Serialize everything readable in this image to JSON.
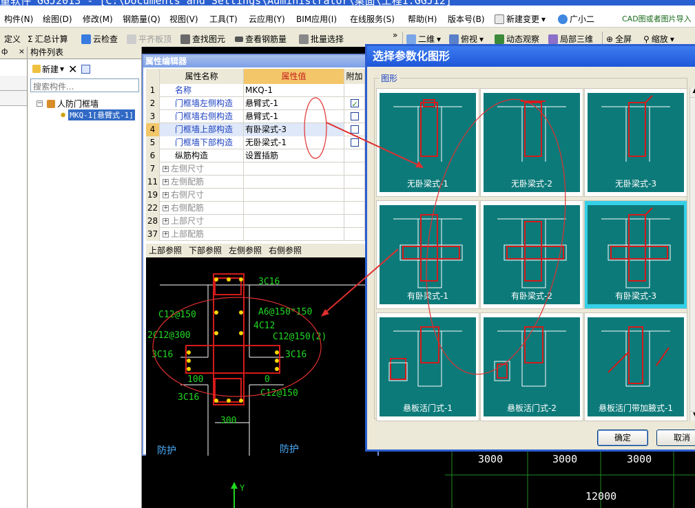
{
  "title": "量软件 GGJ2013 - [C:\\Documents and Settings\\Administrator\\桌面\\工程1.GGJ12]",
  "menu": [
    "构件(N)",
    "绘图(D)",
    "修改(M)",
    "钢筋量(Q)",
    "视图(V)",
    "工具(T)",
    "云应用(Y)",
    "BIM应用(I)",
    "在线服务(S)",
    "帮助(H)",
    "版本号(B)",
    "新建变更",
    "广小二"
  ],
  "menu_right": "CAD图或者图片导入",
  "toolbar": [
    "定义",
    "汇总计算",
    "云检查",
    "平齐板顶",
    "查找图元",
    "查看钢筋量",
    "批量选择",
    "二维",
    "俯视",
    "动态观察",
    "局部三维",
    "全屏",
    "缩放"
  ],
  "left_panel": {
    "pin": "ф",
    "close": "×"
  },
  "component_list": {
    "header": "构件列表",
    "new_label": "新建",
    "search_placeholder": "搜索构件...",
    "tree_parent": "人防门框墙",
    "tree_child": "MKQ-1[悬臂式-1]"
  },
  "property_editor": {
    "title": "属性编辑器",
    "columns": [
      "属性名称",
      "属性值",
      "附加"
    ],
    "rows": [
      {
        "num": "1",
        "name": "名称",
        "value": "MKQ-1",
        "style": "blue",
        "check": ""
      },
      {
        "num": "2",
        "name": "门框墙左侧构造",
        "value": "悬臂式-1",
        "style": "blue",
        "check": "checked"
      },
      {
        "num": "3",
        "name": "门框墙右侧构造",
        "value": "悬臂式-1",
        "style": "blue",
        "check": "empty"
      },
      {
        "num": "4",
        "name": "门框墙上部构造",
        "value": "有卧梁式-3",
        "style": "blue",
        "check": "empty"
      },
      {
        "num": "5",
        "name": "门框墙下部构造",
        "value": "无卧梁式-1",
        "style": "blue",
        "check": "empty"
      },
      {
        "num": "6",
        "name": "纵筋构造",
        "value": "设置插筋",
        "style": "black",
        "check": ""
      },
      {
        "num": "7",
        "name": "左侧尺寸",
        "value": "",
        "style": "gray",
        "check": ""
      },
      {
        "num": "11",
        "name": "左侧配筋",
        "value": "",
        "style": "gray",
        "check": ""
      },
      {
        "num": "19",
        "name": "右侧尺寸",
        "value": "",
        "style": "gray",
        "check": ""
      },
      {
        "num": "22",
        "name": "右侧配筋",
        "value": "",
        "style": "gray",
        "check": ""
      },
      {
        "num": "28",
        "name": "上部尺寸",
        "value": "",
        "style": "gray",
        "check": ""
      },
      {
        "num": "37",
        "name": "上部配筋",
        "value": "",
        "style": "gray",
        "check": ""
      }
    ],
    "tabs": [
      "上部参照",
      "下部参照",
      "左侧参照",
      "右侧参照"
    ],
    "preview_labels": [
      "3C16",
      "C12@150",
      "A6@150*150",
      "4C12",
      "2C12@300",
      "C12@150(2)",
      "3C16",
      "3C16",
      "100",
      "0",
      "3C16",
      "C12@150",
      "300",
      "防护",
      "防护"
    ]
  },
  "dialog": {
    "title": "选择参数化图形",
    "group_label": "图形",
    "tiles": [
      "无卧梁式-1",
      "无卧梁式-2",
      "无卧梁式-3",
      "有卧梁式-1",
      "有卧梁式-2",
      "有卧梁式-3",
      "悬板活门式-1",
      "悬板活门式-2",
      "悬板活门带加腋式-1"
    ],
    "selected_tile": "有卧梁式-3",
    "ok_label": "确定",
    "cancel_label": "取消"
  },
  "canvas_dims": [
    "3000",
    "3000",
    "3000",
    "12000"
  ],
  "axis_label": "Y",
  "colors": {
    "teal": "#0d7a7a",
    "rebar_red": "#d51a1a",
    "annotation_red": "#e03030",
    "cad_green": "#21d821",
    "selected_cyan": "#35d0e8"
  }
}
